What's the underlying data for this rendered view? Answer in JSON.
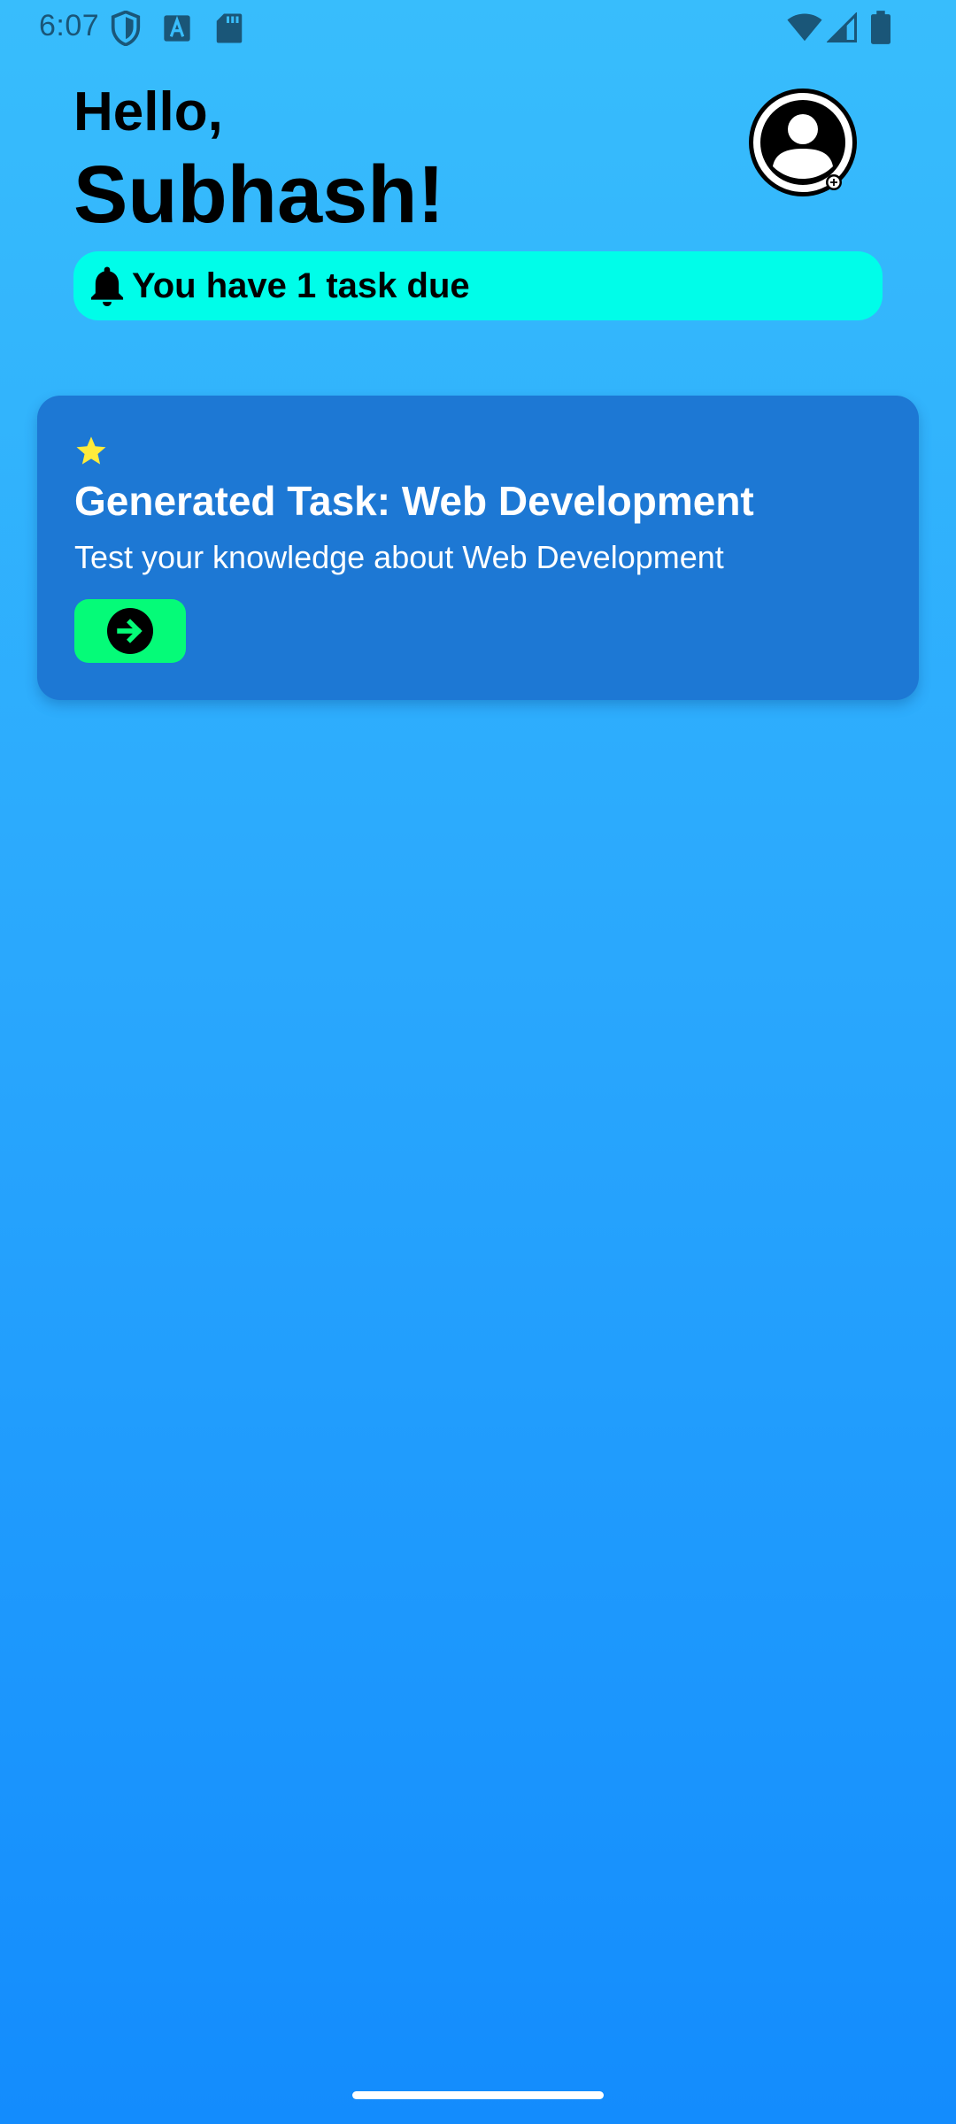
{
  "status_bar": {
    "time": "6:07",
    "icons": [
      "shield-icon",
      "font-icon",
      "sd-card-icon",
      "wifi-icon",
      "signal-icon",
      "battery-icon"
    ]
  },
  "header": {
    "greeting": "Hello,",
    "user_name": "Subhash!",
    "avatar_icon": "account-circle-icon"
  },
  "banner": {
    "icon": "bell-icon",
    "text": "You have 1 task due"
  },
  "task_card": {
    "icon": "star-icon",
    "title": "Generated Task: Web Development",
    "subtitle": "Test your knowledge about Web Development",
    "button_icon": "arrow-right-circle-icon"
  },
  "colors": {
    "background_top": "#38bdfc",
    "background_bottom": "#138cfd",
    "banner": "#00fde9",
    "card": "#1d78d4",
    "button": "#05fb78",
    "star": "#ffeb3b"
  }
}
